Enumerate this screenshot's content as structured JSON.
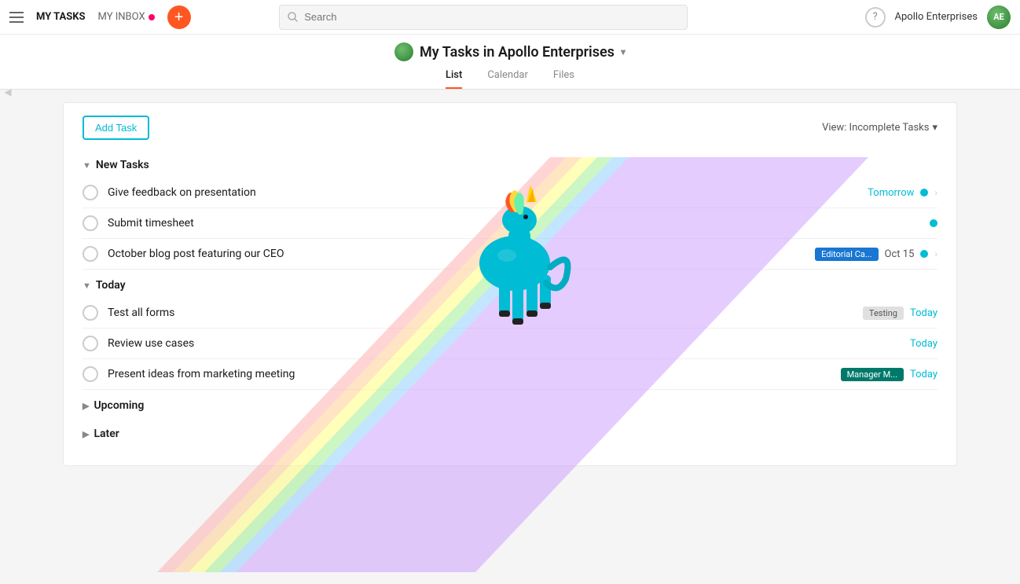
{
  "topnav": {
    "my_tasks_label": "MY TASKS",
    "my_inbox_label": "MY INBOX",
    "add_btn_label": "+",
    "search_placeholder": "Search",
    "help_label": "?",
    "org_name": "Apollo Enterprises"
  },
  "subheader": {
    "title": "My Tasks in Apollo Enterprises",
    "dropdown_arrow": "▾",
    "tabs": [
      {
        "label": "List",
        "active": true
      },
      {
        "label": "Calendar",
        "active": false
      },
      {
        "label": "Files",
        "active": false
      }
    ]
  },
  "toolbar": {
    "add_task_label": "Add Task",
    "view_label": "View: Incomplete Tasks",
    "view_arrow": "▾"
  },
  "sections": [
    {
      "id": "new-tasks",
      "label": "New Tasks",
      "tasks": [
        {
          "name": "Give feedback on presentation",
          "date": "Tomorrow",
          "date_type": "tomorrow",
          "dot": true,
          "chevron": true,
          "project": null
        },
        {
          "name": "Submit timesheet",
          "date": null,
          "date_type": null,
          "dot": true,
          "chevron": false,
          "project": null
        },
        {
          "name": "October blog post featuring our CEO",
          "date": "Oct 15",
          "date_type": "oct",
          "dot": true,
          "chevron": true,
          "project": "Editorial Ca..."
        }
      ]
    },
    {
      "id": "today",
      "label": "Today",
      "tasks": [
        {
          "name": "Test all forms",
          "date": "Today",
          "date_type": "today",
          "dot": false,
          "chevron": false,
          "project": "Testing",
          "project_style": "tag-testing"
        },
        {
          "name": "Review use cases",
          "date": "Today",
          "date_type": "today",
          "dot": false,
          "chevron": false,
          "project": null
        },
        {
          "name": "Present ideas from marketing meeting",
          "date": "Today",
          "date_type": "today",
          "dot": false,
          "chevron": false,
          "project": "Manager M...",
          "project_style": "project-tag"
        }
      ]
    },
    {
      "id": "upcoming",
      "label": "Upcoming",
      "tasks": []
    },
    {
      "id": "later",
      "label": "Later",
      "tasks": []
    }
  ],
  "rainbow": {
    "colors": [
      "#ff9999",
      "#ffcc88",
      "#ffff88",
      "#99ff99",
      "#88ccff",
      "#cc99ff"
    ],
    "offsets": [
      60,
      88,
      116,
      144,
      172,
      200
    ]
  }
}
